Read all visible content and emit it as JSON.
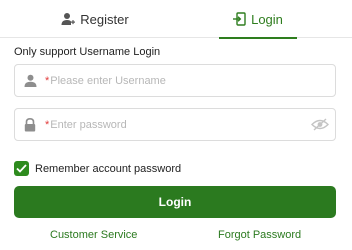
{
  "tabs": {
    "register": {
      "label": "Register",
      "icon": "user-plus-icon"
    },
    "login": {
      "label": "Login",
      "icon": "login-door-icon",
      "active": true
    }
  },
  "subtitle": "Only support Username Login",
  "username": {
    "required_mark": "*",
    "placeholder": "Please enter Username",
    "value": "",
    "icon": "user-icon"
  },
  "password": {
    "required_mark": "*",
    "placeholder": "Enter password",
    "value": "",
    "icon": "lock-icon",
    "toggle_icon": "eye-slash-icon"
  },
  "remember": {
    "label": "Remember account password",
    "checked": true
  },
  "login_button": "Login",
  "links": {
    "customer_service": "Customer Service",
    "forgot_password": "Forgot Password"
  },
  "colors": {
    "accent": "#2b7a1f",
    "required": "#e23a3a"
  }
}
